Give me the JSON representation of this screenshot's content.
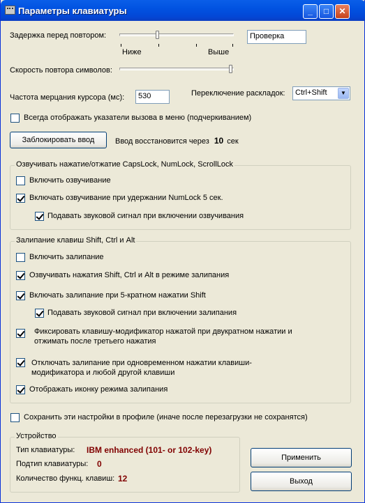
{
  "window": {
    "title": "Параметры клавиатуры",
    "minimize": "_",
    "maximize": "□",
    "close": "✕"
  },
  "repeat": {
    "delay_label": "Задержка перед повтором:",
    "delay_level": 0.33,
    "low_label": "Ниже",
    "high_label": "Выше",
    "test_value": "Проверка",
    "rate_label": "Скорость повтора символов:",
    "rate_level": 1.0
  },
  "cursor": {
    "blink_label": "Частота мерцания курсора (мс):",
    "blink_value": "530"
  },
  "layout_switch": {
    "label": "Переключение раскладок:",
    "value": "Ctrl+Shift"
  },
  "underline_option": {
    "label": "Всегда отображать указатели вызова в меню (подчеркиванием)",
    "checked": false
  },
  "block": {
    "button_label": "Заблокировать ввод",
    "restore_prefix": "Ввод восстановится через",
    "restore_value": "10",
    "restore_unit": "сек"
  },
  "sound_group": {
    "title": "Озвучивать нажатие/отжатие CapsLock, NumLock, ScrollLock",
    "items": [
      {
        "label": "Включить озвучивание",
        "checked": false
      },
      {
        "label": "Включать озвучивание при удержании NumLock 5 сек.",
        "checked": true
      },
      {
        "label": "Подавать звуковой сигнал при включении озвучивания",
        "checked": true
      }
    ]
  },
  "sticky_group": {
    "title": "Залипание клавиш Shift, Ctrl и Alt",
    "items": [
      {
        "label": "Включить залипание",
        "checked": false
      },
      {
        "label": "Озвучивать нажатия Shift, Ctrl и Alt в режиме залипания",
        "checked": true
      },
      {
        "label": "Включать залипание при 5-кратном нажатии Shift",
        "checked": true
      },
      {
        "label": "Подавать звуковой сигнал при включении залипания",
        "checked": true
      },
      {
        "label_line1": "Фиксировать клавишу-модификатор нажатой при двукратном нажатии и",
        "label_line2": "отжимать после третьего нажатия",
        "checked": true
      },
      {
        "label_line1": "Отключать залипание при одновременном нажатии клавиши-",
        "label_line2": "модификатора и любой другой клавиши",
        "checked": true
      },
      {
        "label": "Отображать иконку режима залипания",
        "checked": true
      }
    ]
  },
  "save_profile": {
    "label": "Сохранить эти настройки в профиле (иначе после перезагрузки не сохранятся)",
    "checked": false
  },
  "device": {
    "title": "Устройство",
    "type_label": "Тип клавиатуры:",
    "type_value": "IBM enhanced (101- or 102-key)",
    "subtype_label": "Подтип клавиатуры:",
    "subtype_value": "0",
    "fkeys_label": "Количество функц. клавиш:",
    "fkeys_value": "12"
  },
  "buttons": {
    "apply": "Применить",
    "exit": "Выход"
  }
}
